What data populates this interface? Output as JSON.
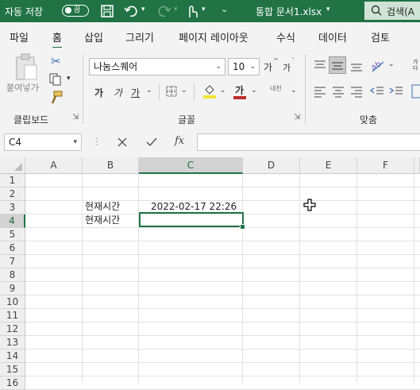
{
  "titlebar": {
    "autosave_label": "자동 저장",
    "autosave_state": "끔",
    "filename": "통합 문서1.xlsx",
    "search_label": "검색(A"
  },
  "menu": {
    "items": [
      "파일",
      "홈",
      "삽입",
      "그리기",
      "페이지 레이아웃",
      "수식",
      "데이터",
      "검토"
    ],
    "active": "홈"
  },
  "ribbon": {
    "clipboard": {
      "paste_label": "붙여넣기",
      "group_label": "클립보드"
    },
    "font": {
      "font_name": "나눔스퀘어",
      "font_size": "10",
      "bold": "가",
      "italic": "가",
      "underline": "가",
      "grow": "가",
      "shrink": "가",
      "font_color": "가",
      "phonetic": "내천",
      "group_label": "글꼴",
      "accent_colors": {
        "fill": "#f5e23a",
        "font": "#c0292b"
      }
    },
    "alignment": {
      "wrap": "가다",
      "group_label": "맞춤"
    }
  },
  "formula_bar": {
    "name_box": "C4",
    "fx_label": "fx",
    "value": ""
  },
  "sheet": {
    "columns": [
      "A",
      "B",
      "C",
      "D",
      "E",
      "F"
    ],
    "selected_column": "C",
    "rows": [
      "1",
      "2",
      "3",
      "4",
      "5",
      "6",
      "7",
      "8",
      "9",
      "10",
      "11",
      "12",
      "13",
      "14",
      "15",
      "16"
    ],
    "selected_row": "4",
    "cells": {
      "B3": "현재시간",
      "C3": "2022-02-17 22:26",
      "B4": "현재시간"
    }
  },
  "colors": {
    "brand": "#217346"
  }
}
